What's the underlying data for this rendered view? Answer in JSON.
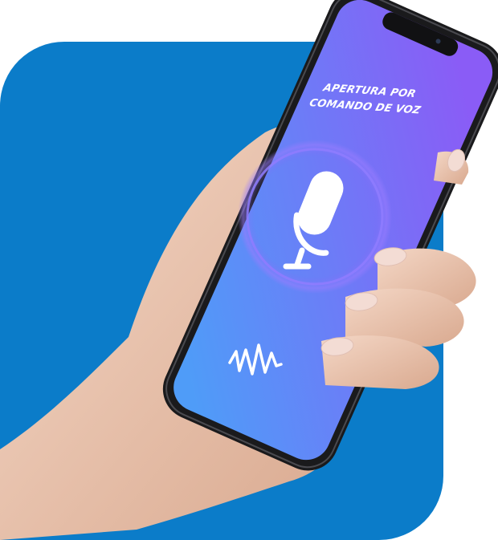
{
  "screen": {
    "title_line1": "APERTURA POR",
    "title_line2": "COMANDO DE VOZ"
  },
  "icons": {
    "mic": "microphone-icon",
    "wave": "sound-wave-icon"
  },
  "colors": {
    "panel_blue": "#0b7cc9",
    "screen_top": "#8a5cf6",
    "screen_bottom": "#4f9cf8",
    "phone_body": "#1a1a1c",
    "skin": "#eec9b4",
    "nail": "#f3dcd4"
  }
}
